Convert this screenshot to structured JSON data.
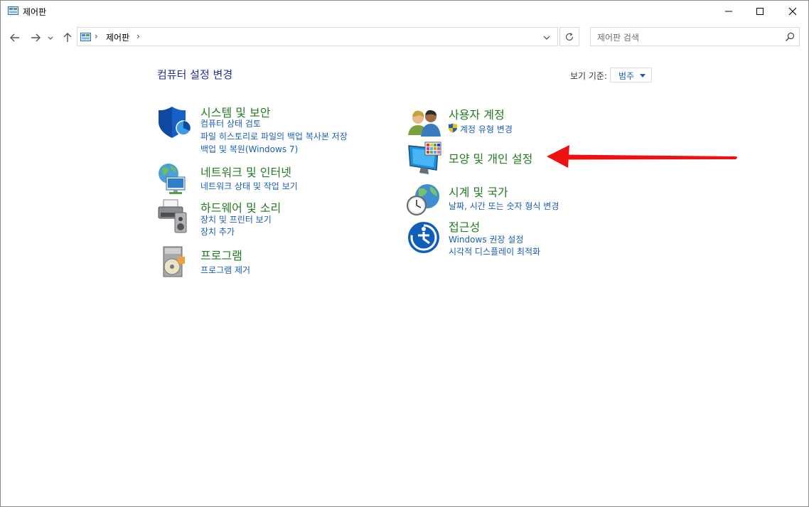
{
  "window": {
    "title": "제어판"
  },
  "address": {
    "path_segment": "제어판",
    "separator": "›",
    "search_placeholder": "제어판 검색"
  },
  "header": {
    "heading": "컴퓨터 설정 변경",
    "view_by_label": "보기 기준:",
    "view_by_value": "범주"
  },
  "categories": {
    "system": {
      "title": "시스템 및 보안",
      "links": [
        "컴퓨터 상태 검토",
        "파일 히스토리로 파일의 백업 복사본 저장",
        "백업 및 복원(Windows 7)"
      ]
    },
    "network": {
      "title": "네트워크 및 인터넷",
      "links": [
        "네트워크 상태 및 작업 보기"
      ]
    },
    "hardware": {
      "title": "하드웨어 및 소리",
      "links": [
        "장치 및 프린터 보기",
        "장치 추가"
      ]
    },
    "programs": {
      "title": "프로그램",
      "links": [
        "프로그램 제거"
      ]
    },
    "users": {
      "title": "사용자 계정",
      "links": [
        "계정 유형 변경"
      ]
    },
    "appearance": {
      "title": "모양 및 개인 설정",
      "links": []
    },
    "clock": {
      "title": "시계 및 국가",
      "links": [
        "날짜, 시간 또는 숫자 형식 변경"
      ]
    },
    "ease": {
      "title": "접근성",
      "links": [
        "Windows 권장 설정",
        "시각적 디스플레이 최적화"
      ]
    }
  },
  "colors": {
    "category_title": "#237b23",
    "link": "#1a5fb4",
    "heading": "#1e3287",
    "annotation_arrow": "#ee1111"
  },
  "icons": {
    "window": "control-panel-icon",
    "back": "arrow-left-icon",
    "forward": "arrow-right-icon",
    "recent": "chevron-down-icon",
    "up": "arrow-up-icon",
    "refresh": "refresh-icon",
    "search": "search-icon"
  }
}
